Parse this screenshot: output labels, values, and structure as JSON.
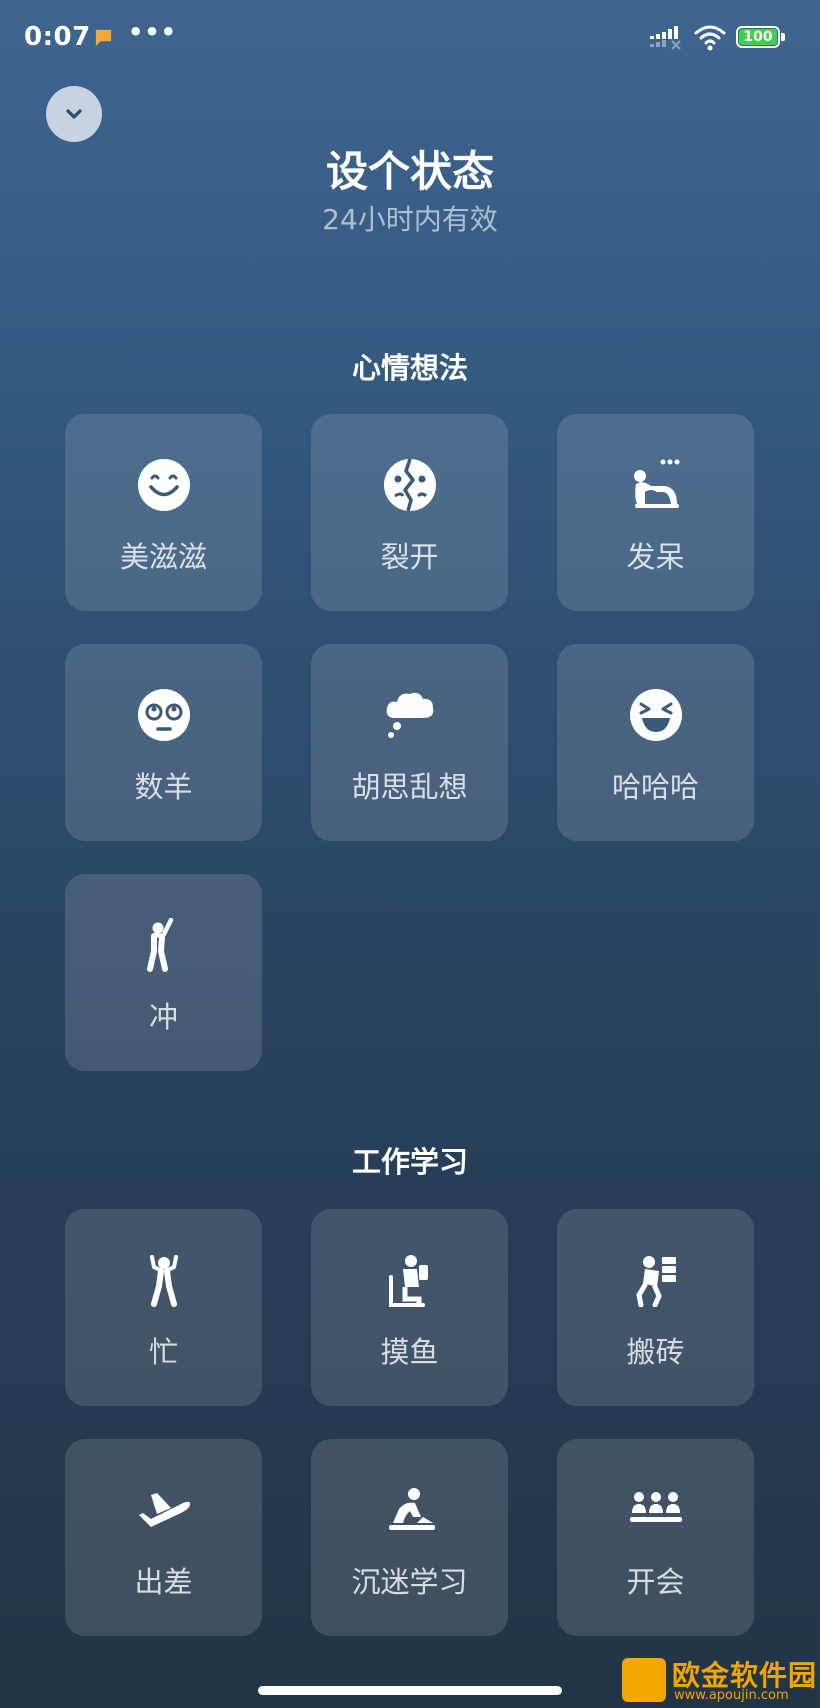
{
  "status_bar": {
    "time": "0:07",
    "dots": "•••",
    "battery": "100",
    "battery_color": "#3fd04f"
  },
  "header": {
    "title": "设个状态",
    "subtitle": "24小时内有效",
    "collapse_icon": "chevron-down-icon"
  },
  "sections": [
    {
      "title": "心情想法",
      "items": [
        {
          "label": "美滋滋",
          "icon": "smile-icon"
        },
        {
          "label": "裂开",
          "icon": "cracked-face-icon"
        },
        {
          "label": "发呆",
          "icon": "daze-person-icon"
        },
        {
          "label": "数羊",
          "icon": "sleepy-face-icon"
        },
        {
          "label": "胡思乱想",
          "icon": "thought-bubble-icon"
        },
        {
          "label": "哈哈哈",
          "icon": "laughing-face-icon"
        },
        {
          "label": "冲",
          "icon": "rush-person-icon"
        }
      ]
    },
    {
      "title": "工作学习",
      "items": [
        {
          "label": "忙",
          "icon": "busy-person-icon"
        },
        {
          "label": "摸鱼",
          "icon": "slacking-person-icon"
        },
        {
          "label": "搬砖",
          "icon": "carrying-bricks-icon"
        },
        {
          "label": "出差",
          "icon": "airplane-icon"
        },
        {
          "label": "沉迷学习",
          "icon": "studying-person-icon"
        },
        {
          "label": "开会",
          "icon": "meeting-icon"
        }
      ]
    }
  ],
  "watermark": {
    "text": "欧金软件园",
    "sub": "www.apoujin.com",
    "color": "#f3a600"
  }
}
